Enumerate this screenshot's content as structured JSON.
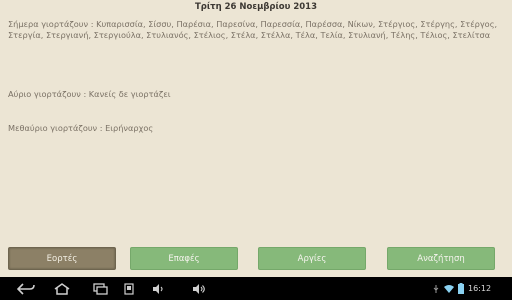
{
  "header": {
    "date": "Τρίτη 26  Νοεμβρίου 2013"
  },
  "celebrations": {
    "today": "Σήμερα γιορτάζουν : Κυπαρισσία, Σίσσυ, Παρέσια, Παρεσίνα, Παρεσσία, Παρέσσα, Νίκων, Στέργιος, Στέργης, Στέργος, Στεργία, Στεργιανή, Στεργιούλα, Στυλιανός, Στέλιος, Στέλα, Στέλλα, Τέλα, Τελία, Στυλιανή, Τέλης, Τέλιος, Στελίτσα",
    "tomorrow": "Αύριο γιορτάζουν : Κανείς δε γιορτάζει",
    "day_after": "Μεθαύριο γιορτάζουν : Ειρήναρχος"
  },
  "buttons": [
    {
      "label": "Εορτές",
      "active": true
    },
    {
      "label": "Επαφές",
      "active": false
    },
    {
      "label": "Αργίες",
      "active": false
    },
    {
      "label": "Αναζήτηση",
      "active": false
    }
  ],
  "system_bar": {
    "clock": "16:12",
    "icons": [
      "back-icon",
      "home-icon",
      "recent-apps-icon",
      "screenshot-icon",
      "volume-down-icon",
      "volume-up-icon",
      "usb-icon",
      "wifi-icon",
      "battery-icon"
    ]
  }
}
